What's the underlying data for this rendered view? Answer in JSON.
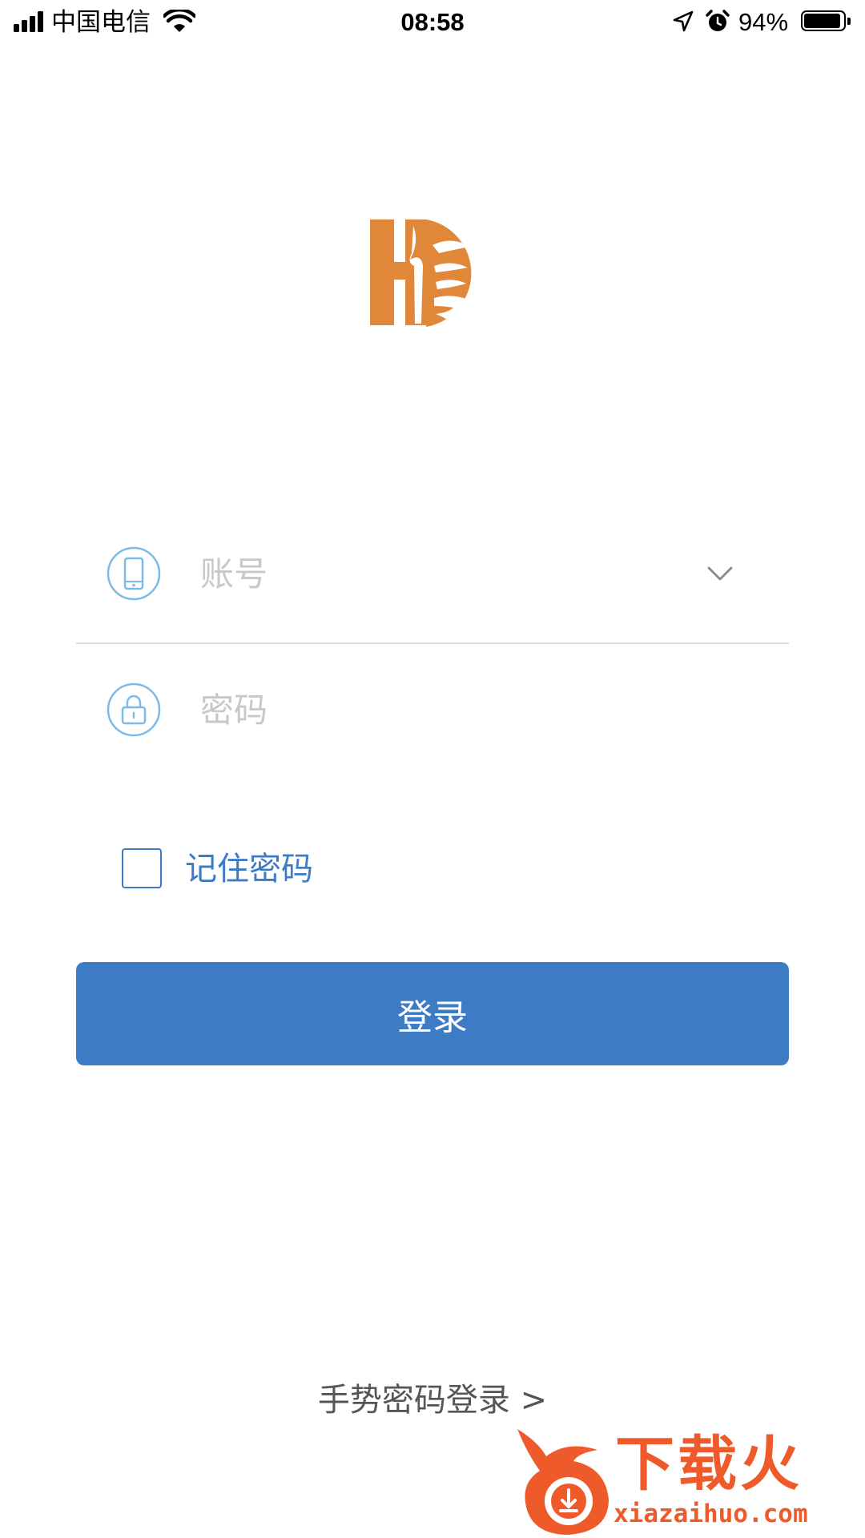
{
  "status_bar": {
    "carrier": "中国电信",
    "time": "08:58",
    "battery": "94%",
    "battery_level": 0.94,
    "icons": [
      "signal-icon",
      "wifi-icon",
      "location-icon",
      "alarm-icon",
      "battery-icon"
    ]
  },
  "logo": {
    "icon": "h-xin-logo",
    "brand_color": "#e0873a"
  },
  "login_form": {
    "account_placeholder": "账号",
    "password_placeholder": "密码",
    "account_icon": "phone-icon",
    "password_icon": "lock-icon",
    "dropdown_icon": "chevron-down-icon",
    "remember_label": "记住密码",
    "remember_checked": false,
    "login_button": "登录",
    "accent_color": "#3d7bc4"
  },
  "gesture_link": "手势密码登录 >",
  "watermark": {
    "text": "下载火",
    "url": "xiazaihuo.com",
    "color": "#ef5a2a"
  }
}
